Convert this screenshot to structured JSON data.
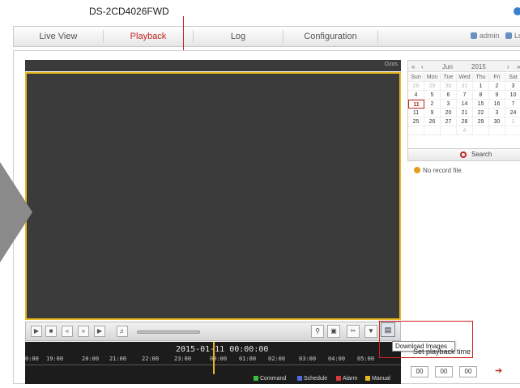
{
  "header": {
    "model": "DS-2CD4026FWD"
  },
  "nav": {
    "tabs": [
      {
        "label": "Live View"
      },
      {
        "label": "Playback"
      },
      {
        "label": "Log"
      },
      {
        "label": "Configuration"
      }
    ],
    "active_tab": "Playback",
    "user": "admin",
    "user_extra": "Lo"
  },
  "video": {
    "label": "Ozos"
  },
  "timeline": {
    "datetime": "2015-01-11 00:00:00",
    "ticks": [
      "0:00",
      "19:00",
      "20:00",
      "21:00",
      "22:00",
      "23:00",
      "00:00",
      "01:00",
      "02:00",
      "03:00",
      "04:00",
      "05:00"
    ]
  },
  "legend": [
    {
      "label": "Command",
      "color": "#3bbf3b"
    },
    {
      "label": "Schedule",
      "color": "#4e6be0"
    },
    {
      "label": "Alarm",
      "color": "#d83a3a"
    },
    {
      "label": "Manual",
      "color": "#e8b820"
    }
  ],
  "calendar": {
    "month": "Jun",
    "year": "2015",
    "days_of_week": [
      "Sun",
      "Mon",
      "Tue",
      "Wed",
      "Thu",
      "Fri",
      "Sat"
    ],
    "weeks": [
      [
        "28",
        "29",
        "30",
        "31",
        "1",
        "2",
        "3"
      ],
      [
        "4",
        "5",
        "6",
        "7",
        "8",
        "9",
        "10"
      ],
      [
        "11",
        "2",
        "3",
        "14",
        "15",
        "16",
        "7"
      ],
      [
        "11",
        "9",
        "20",
        "21",
        "22",
        "3",
        "24"
      ],
      [
        "25",
        "26",
        "27",
        "28",
        "29",
        "30",
        "1"
      ],
      [
        "",
        "",
        "",
        "4",
        "",
        "",
        ""
      ]
    ],
    "selected": "11"
  },
  "search": {
    "label": "Search"
  },
  "status": {
    "message": "No record file."
  },
  "tooltip": {
    "text": "Download Images"
  },
  "playback_time": {
    "label": "Set playback time",
    "fields": [
      "00",
      "00",
      "00"
    ]
  }
}
